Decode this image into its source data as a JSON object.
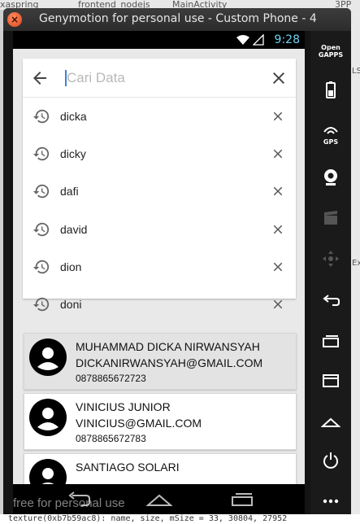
{
  "desktop": {
    "tabs": [
      "xaspring",
      "frontend_nodejs",
      "MainActivity",
      "3PP"
    ],
    "bottom_text": "texture(0xb7b59ac8): name, size, mSize = 33, 30804, 27952",
    "right_fragments": [
      "LS",
      "Ex"
    ]
  },
  "window": {
    "title": "Genymotion for personal use - Custom Phone - 4"
  },
  "statusbar": {
    "time": "9:28"
  },
  "search": {
    "placeholder": "Cari Data",
    "value": ""
  },
  "history": [
    {
      "label": "dicka"
    },
    {
      "label": "dicky"
    },
    {
      "label": "dafi"
    },
    {
      "label": "david"
    },
    {
      "label": "dion"
    },
    {
      "label": "doni"
    }
  ],
  "results": [
    {
      "name": "MUHAMMAD DICKA NIRWANSYAH",
      "email": "DICKANIRWANSYAH@GMAIL.COM",
      "phone": "0878865672723",
      "selected": true
    },
    {
      "name": "VINICIUS JUNIOR",
      "email": "VINICIUS@GMAIL.COM",
      "phone": "0878865672783",
      "selected": false
    },
    {
      "name": "SANTIAGO SOLARI",
      "email": "",
      "phone": "",
      "selected": false
    }
  ],
  "right_panel": {
    "open_gapps_label": "Open\nGAPPS",
    "gps_label": "GPS"
  },
  "watermark": "free for personal use",
  "colors": {
    "accent": "#6fd3f0",
    "cursor": "#3f7fd9",
    "selected_card": "#e3e3e3"
  }
}
